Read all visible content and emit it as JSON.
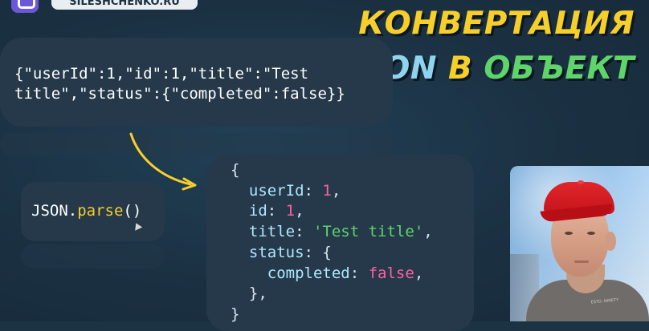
{
  "brand": {
    "badge_text": "SILESHCHENKO.RU"
  },
  "title": {
    "line1": "КОНВЕРТАЦИЯ",
    "line2_json": "JSON",
    "line2_v": "В",
    "line2_obj": "ОБЪЕКТ"
  },
  "json_example": {
    "line1": "{\"userId\":1,\"id\":1,\"title\":\"Test",
    "line2": "title\",\"status\":{\"completed\":false}}"
  },
  "parse_call": {
    "object": "JSON.",
    "method": "parse",
    "parens": "()"
  },
  "object_example": {
    "open_brace": "{",
    "userId_key": "userId",
    "userId_value": "1",
    "id_key": "id",
    "id_value": "1",
    "title_key": "title",
    "title_value": "'Test title'",
    "status_key": "status",
    "status_open": "{",
    "completed_key": "completed",
    "completed_value": "false",
    "status_close": "},",
    "close_brace": "}"
  },
  "colors": {
    "background": "#1c3344",
    "bubble": "#25394a",
    "accent_yellow": "#f6cf2b",
    "accent_blue": "#8fd4ef",
    "accent_green": "#5fd46a",
    "accent_pink": "#ff5fa2"
  },
  "presenter": {
    "shirt_text": "ESTD. NINETY"
  }
}
